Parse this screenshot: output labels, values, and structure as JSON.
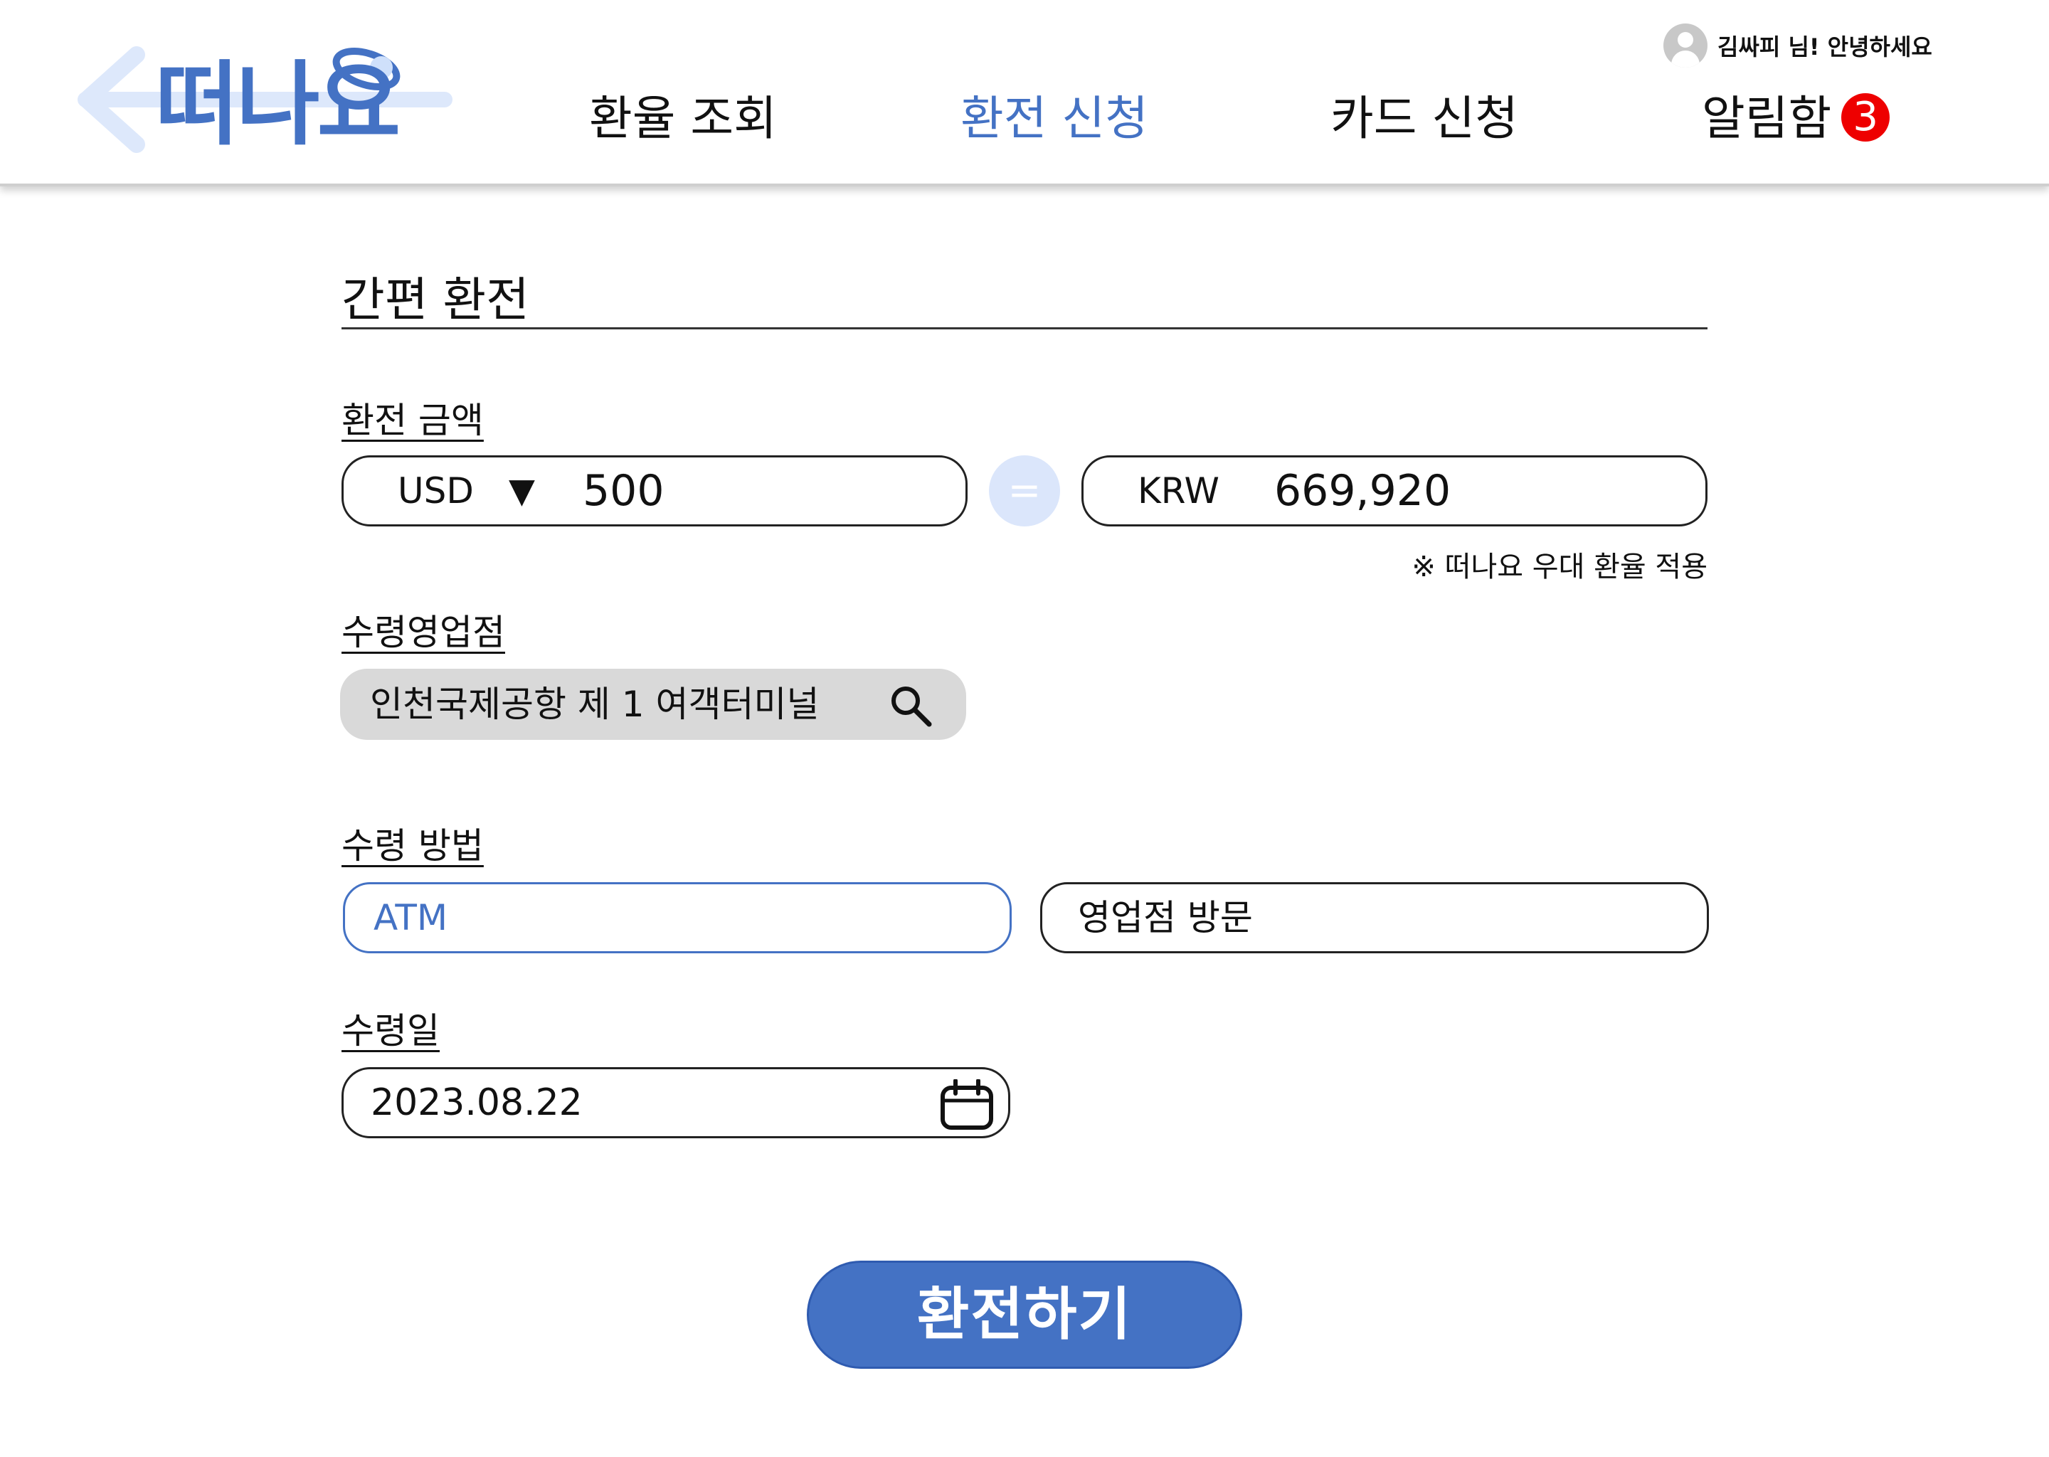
{
  "header": {
    "logo_text": "떠나요",
    "nav": [
      {
        "label": "환율 조회",
        "active": false
      },
      {
        "label": "환전 신청",
        "active": true
      },
      {
        "label": "카드 신청",
        "active": false
      },
      {
        "label": "알림함",
        "active": false,
        "badge": "3"
      }
    ],
    "greeting": "김싸피 님! 안녕하세요"
  },
  "exchange": {
    "title": "간편 환전",
    "amount_label": "환전 금액",
    "from_currency": "USD",
    "from_dropdown_glyph": "▼",
    "from_amount": "500",
    "equals_glyph": "=",
    "to_currency": "KRW",
    "to_amount": "669,920",
    "note": "※ 떠나요 우대 환율 적용",
    "branch_label": "수령영업점",
    "branch_value": "인천국제공항 제 1 여객터미널",
    "method_label": "수령 방법",
    "method_options": [
      "ATM",
      "영업점 방문"
    ],
    "method_selected": "ATM",
    "date_label": "수령일",
    "date_value": "2023.08.22",
    "submit_label": "환전하기"
  },
  "colors": {
    "accent": "#4472c4",
    "badge": "#ee0000",
    "equals_bg": "#dbe6fb",
    "search_bg": "#d9d9d9"
  },
  "icons": [
    "back-arrow-icon",
    "user-avatar-icon",
    "chevron-down-icon",
    "search-icon",
    "calendar-icon"
  ]
}
